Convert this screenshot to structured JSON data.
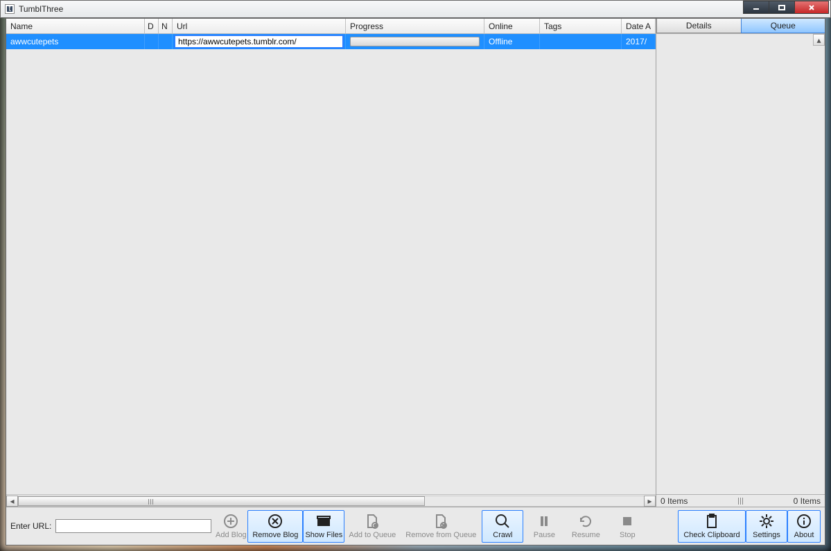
{
  "app": {
    "title": "TumblThree"
  },
  "sidepanel": {
    "tabs": {
      "details": "Details",
      "queue": "Queue"
    },
    "status": {
      "left": "0 Items",
      "right": "0 Items"
    }
  },
  "grid": {
    "headers": {
      "name": "Name",
      "d": "D",
      "n": "N",
      "url": "Url",
      "progress": "Progress",
      "online": "Online",
      "tags": "Tags",
      "date": "Date A"
    },
    "row": {
      "name": "awwcutepets",
      "url": "https://awwcutepets.tumblr.com/",
      "online": "Offline",
      "date": "2017/"
    }
  },
  "bottom": {
    "label": "Enter URL:",
    "buttons": {
      "addblog": "Add Blog",
      "removeblog": "Remove Blog",
      "showfiles": "Show Files",
      "addqueue": "Add to Queue",
      "removequeue": "Remove from Queue",
      "crawl": "Crawl",
      "pause": "Pause",
      "resume": "Resume",
      "stop": "Stop",
      "clipboard": "Check Clipboard",
      "settings": "Settings",
      "about": "About"
    }
  }
}
